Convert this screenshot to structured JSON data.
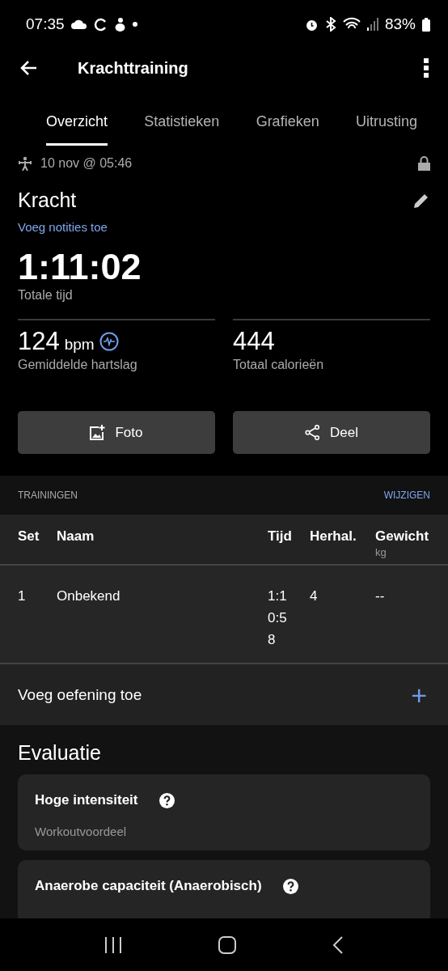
{
  "status_bar": {
    "time": "07:35",
    "battery": "83%"
  },
  "app_bar": {
    "title": "Krachttraining"
  },
  "tabs": [
    {
      "label": "Overzicht",
      "selected": true
    },
    {
      "label": "Statistieken",
      "selected": false
    },
    {
      "label": "Grafieken",
      "selected": false
    },
    {
      "label": "Uitrusting",
      "selected": false
    }
  ],
  "activity": {
    "date": "10 nov @ 05:46",
    "name": "Kracht",
    "notes_link": "Voeg notities toe",
    "total_time": "1:11:02",
    "total_time_label": "Totale tijd"
  },
  "stats": [
    {
      "value": "124",
      "unit": "bpm",
      "label": "Gemiddelde hartslag",
      "kind": "heart"
    },
    {
      "value": "444",
      "label": "Totaal calorieën",
      "kind": "plain"
    }
  ],
  "buttons": [
    {
      "label": "Foto",
      "kind": "photo"
    },
    {
      "label": "Deel",
      "kind": "share"
    }
  ],
  "trainings": {
    "title": "TRAININGEN",
    "action": "WIJZIGEN",
    "columns": [
      {
        "label": "Set"
      },
      {
        "label": "Naam"
      },
      {
        "label": "Tijd"
      },
      {
        "label": "Herhal."
      },
      {
        "label": "Gewicht",
        "unit": "kg"
      }
    ],
    "rows": [
      [
        "1",
        "Onbekend",
        "1:10:58",
        "4",
        "--"
      ]
    ],
    "add_label": "Voeg oefening toe",
    "add_icon": "+"
  },
  "evaluation": {
    "title": "Evaluatie",
    "cards": [
      {
        "title": "Hoge intensiteit",
        "subtitle": "Workoutvoordeel"
      },
      {
        "title": "Anaerobe capaciteit (Anaerobisch)"
      }
    ]
  }
}
